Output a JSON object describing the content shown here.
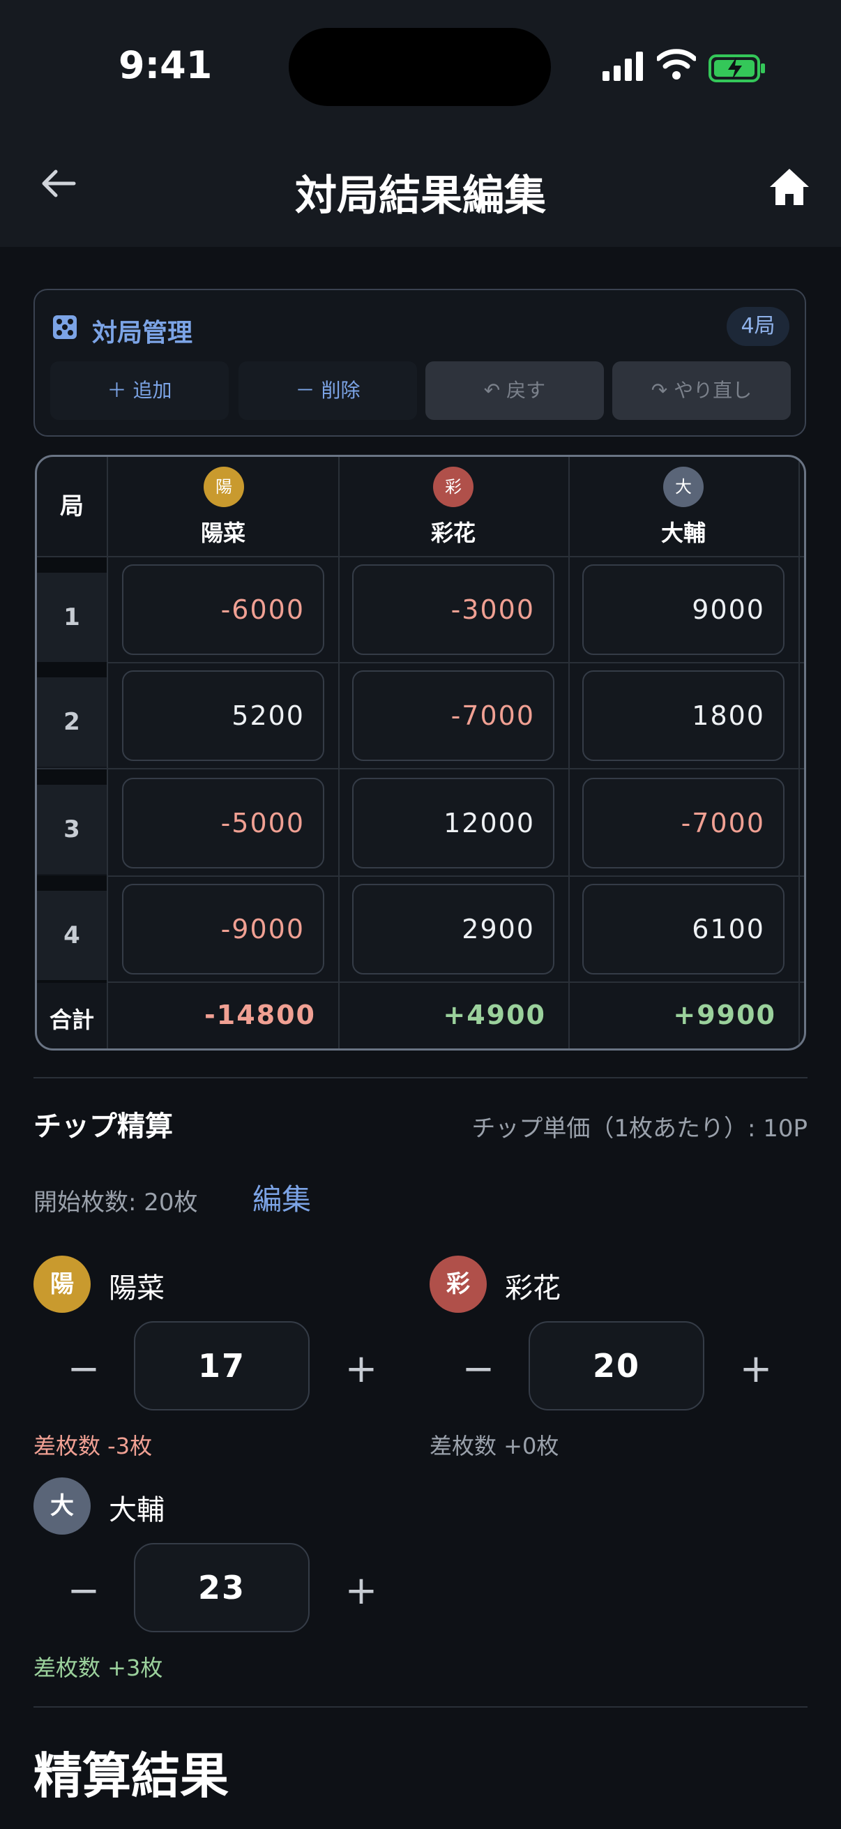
{
  "status": {
    "time": "9:41"
  },
  "header": {
    "title": "対局結果編集"
  },
  "game_management": {
    "label": "対局管理",
    "round_count": "4局",
    "buttons": {
      "add": "＋ 追加",
      "delete": "－ 削除",
      "undo": "戻す",
      "redo": "やり直し"
    }
  },
  "players": [
    {
      "name": "陽菜",
      "initial": "陽",
      "color": "#c99a2e"
    },
    {
      "name": "彩花",
      "initial": "彩",
      "color": "#b0504a"
    },
    {
      "name": "大輔",
      "initial": "大",
      "color": "#5a6578"
    }
  ],
  "score_table": {
    "round_header": "局",
    "rounds": [
      {
        "no": "1",
        "scores": [
          "-6000",
          "-3000",
          "9000"
        ]
      },
      {
        "no": "2",
        "scores": [
          "5200",
          "-7000",
          "1800"
        ]
      },
      {
        "no": "3",
        "scores": [
          "-5000",
          "12000",
          "-7000"
        ]
      },
      {
        "no": "4",
        "scores": [
          "-9000",
          "2900",
          "6100"
        ]
      }
    ],
    "total_label": "合計",
    "totals": [
      "-14800",
      "+4900",
      "+9900"
    ]
  },
  "chip": {
    "title": "チップ精算",
    "unit_price": "チップ単価（1枚あたり）: 10P",
    "start_count": "開始枚数: 20枚",
    "edit_label": "編集",
    "counts": [
      "17",
      "20",
      "23"
    ],
    "diffs": [
      "差枚数 -3枚",
      "差枚数 +0枚",
      "差枚数 +3枚"
    ]
  },
  "settlement": {
    "title": "精算結果"
  }
}
